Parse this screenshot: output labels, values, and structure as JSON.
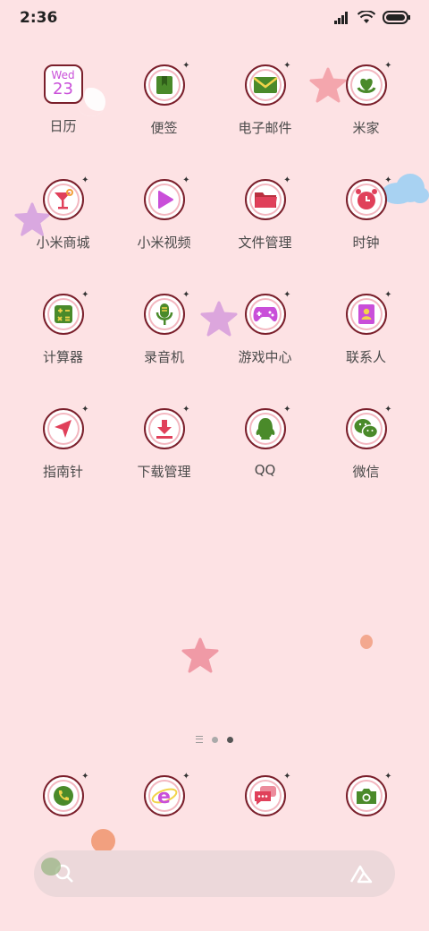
{
  "status_bar": {
    "time": "2:36"
  },
  "apps": [
    [
      {
        "label": "日历",
        "icon": "calendar-icon",
        "day": "Wed",
        "date": "23"
      },
      {
        "label": "便签",
        "icon": "notes-icon"
      },
      {
        "label": "电子邮件",
        "icon": "mail-icon"
      },
      {
        "label": "米家",
        "icon": "mi-home-icon"
      }
    ],
    [
      {
        "label": "小米商城",
        "icon": "mi-store-icon"
      },
      {
        "label": "小米视频",
        "icon": "mi-video-icon"
      },
      {
        "label": "文件管理",
        "icon": "file-manager-icon"
      },
      {
        "label": "时钟",
        "icon": "clock-icon"
      }
    ],
    [
      {
        "label": "计算器",
        "icon": "calculator-icon"
      },
      {
        "label": "录音机",
        "icon": "recorder-icon"
      },
      {
        "label": "游戏中心",
        "icon": "game-center-icon"
      },
      {
        "label": "联系人",
        "icon": "contacts-icon"
      }
    ],
    [
      {
        "label": "指南针",
        "icon": "compass-icon"
      },
      {
        "label": "下载管理",
        "icon": "downloads-icon"
      },
      {
        "label": "QQ",
        "icon": "qq-icon"
      },
      {
        "label": "微信",
        "icon": "wechat-icon"
      }
    ]
  ],
  "dock": [
    {
      "icon": "phone-icon"
    },
    {
      "icon": "browser-icon"
    },
    {
      "icon": "messages-icon"
    },
    {
      "icon": "camera-icon"
    }
  ],
  "pager": {
    "pages": 2,
    "active": 2
  },
  "colors": {
    "background": "#fde2e4",
    "icon_border": "#7a1f2b",
    "accent_purple": "#c94fd9",
    "accent_green": "#4a8a2a",
    "accent_red": "#e0405a"
  }
}
